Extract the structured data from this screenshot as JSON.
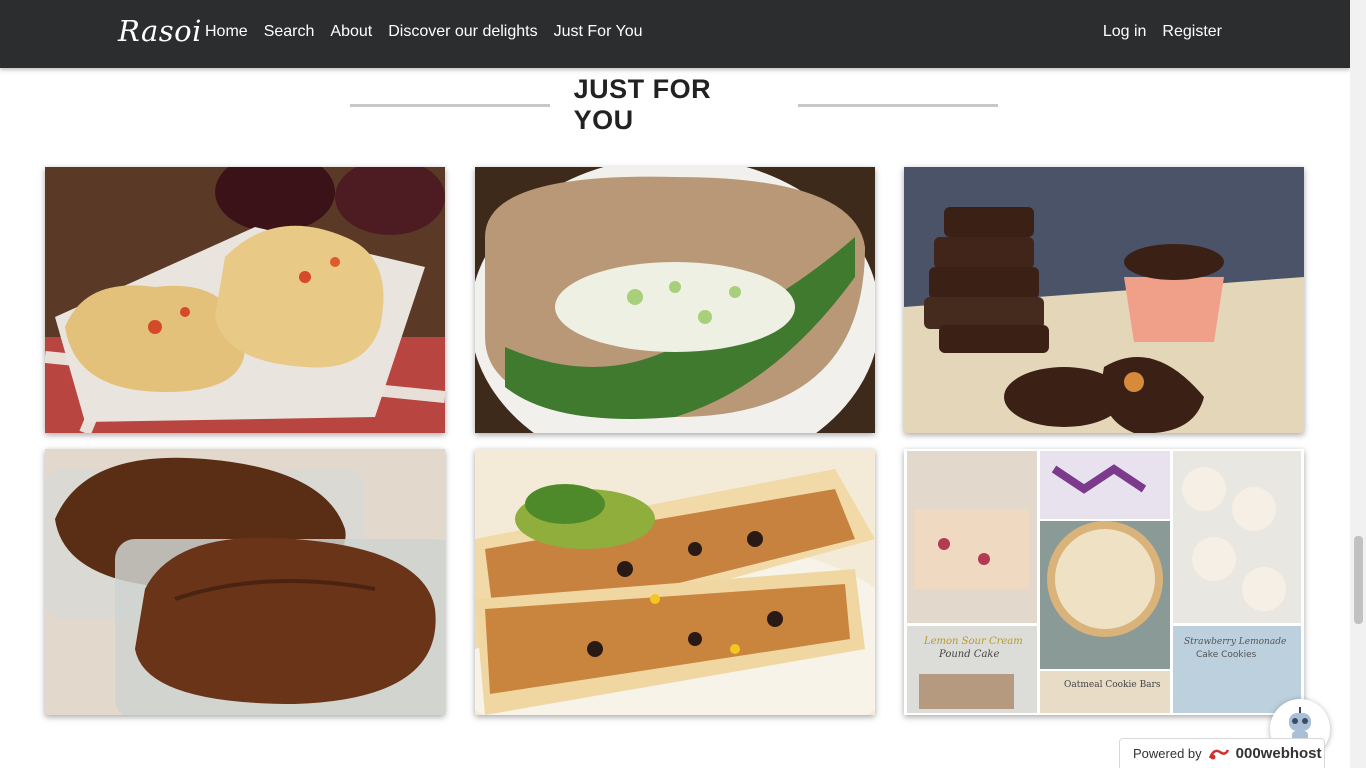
{
  "navbar": {
    "brand": "Rasoi",
    "links": [
      "Home",
      "Search",
      "About",
      "Discover our delights",
      "Just For You"
    ],
    "right_links": [
      "Log in",
      "Register"
    ]
  },
  "section": {
    "title": "JUST FOR YOU"
  },
  "cards": [
    {
      "name": "focaccia-bread"
    },
    {
      "name": "chicken-salad-pita"
    },
    {
      "name": "chocolate-peanut-butter-cups"
    },
    {
      "name": "zucchini-bread-loaves"
    },
    {
      "name": "black-bean-quesadillas"
    },
    {
      "name": "baked-goods-collage",
      "captions": [
        "Lemon Sour Cream Pound Cake",
        "Oatmeal Cookie Bars",
        "Strawberry Lemonade Cake Cookies"
      ]
    }
  ],
  "footer": {
    "powered_by": "Powered by",
    "host": "000webhost"
  },
  "colors": {
    "navbar": "#2b2d2f",
    "title_line": "#c8c8c8",
    "host_accent": "#d32f2f"
  }
}
